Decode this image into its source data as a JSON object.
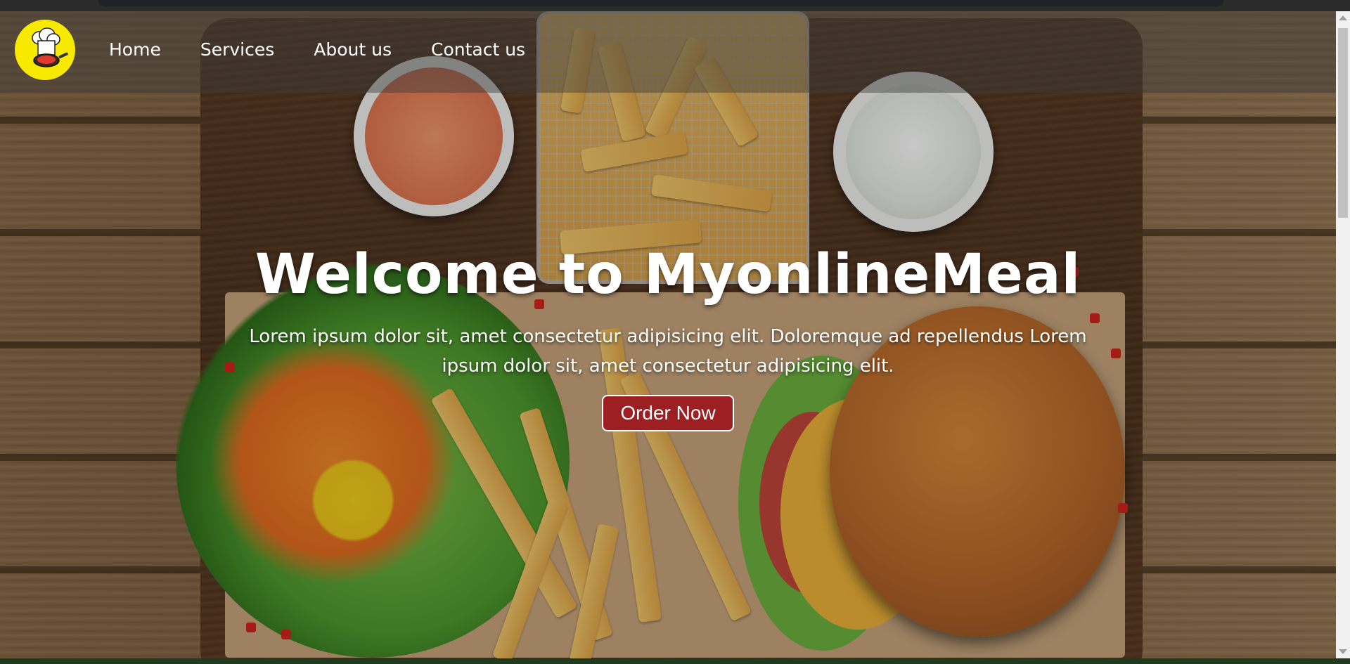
{
  "nav": {
    "logo_icon": "chef-logo-icon",
    "links": [
      {
        "label": "Home"
      },
      {
        "label": "Services"
      },
      {
        "label": "About us"
      },
      {
        "label": "Contact us"
      }
    ]
  },
  "hero": {
    "title": "Welcome to MyonlineMeal",
    "paragraph": "Lorem ipsum dolor sit, amet consectetur adipisicing elit. Doloremque ad repellendus Lorem ipsum dolor sit, amet consectetur adipisicing elit.",
    "button_label": "Order Now",
    "button_color": "#9e1f22"
  },
  "colors": {
    "logo_bg": "#f7ea00",
    "nav_text": "#ffffff"
  }
}
